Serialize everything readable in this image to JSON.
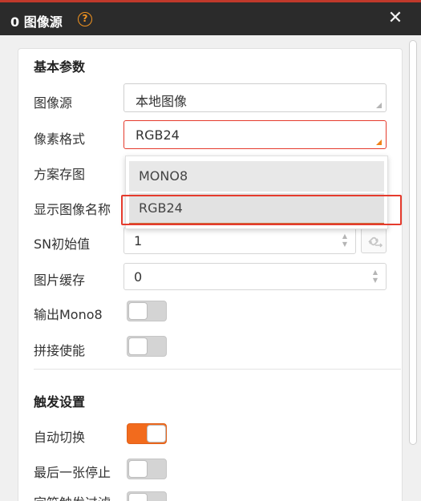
{
  "window": {
    "title": "0 图像源",
    "help_icon": "question-circle-icon",
    "close_icon": "close-icon",
    "accent_color": "#f26b1d",
    "highlight_color": "#e53b2d"
  },
  "basic": {
    "section_title": "基本参数",
    "image_source": {
      "label": "图像源",
      "value": "本地图像"
    },
    "pixel_format": {
      "label": "像素格式",
      "value": "RGB24"
    },
    "scheme_save": {
      "label": "方案存图"
    },
    "show_image_name": {
      "label": "显示图像名称"
    },
    "sn_initial": {
      "label": "SN初始值",
      "value": "1",
      "link_icon": "link-icon"
    },
    "image_cache": {
      "label": "图片缓存",
      "value": "0"
    },
    "output_mono8": {
      "label": "输出Mono8",
      "enabled": false
    },
    "stitch_enable": {
      "label": "拼接使能",
      "enabled": false
    }
  },
  "dropdown": {
    "options": [
      "MONO8",
      "RGB24"
    ],
    "selected": "RGB24"
  },
  "trigger": {
    "section_title": "触发设置",
    "auto_switch": {
      "label": "自动切换",
      "enabled": true
    },
    "stop_last": {
      "label": "最后一张停止",
      "enabled": false
    },
    "partial_label": "字符触发过滤"
  }
}
